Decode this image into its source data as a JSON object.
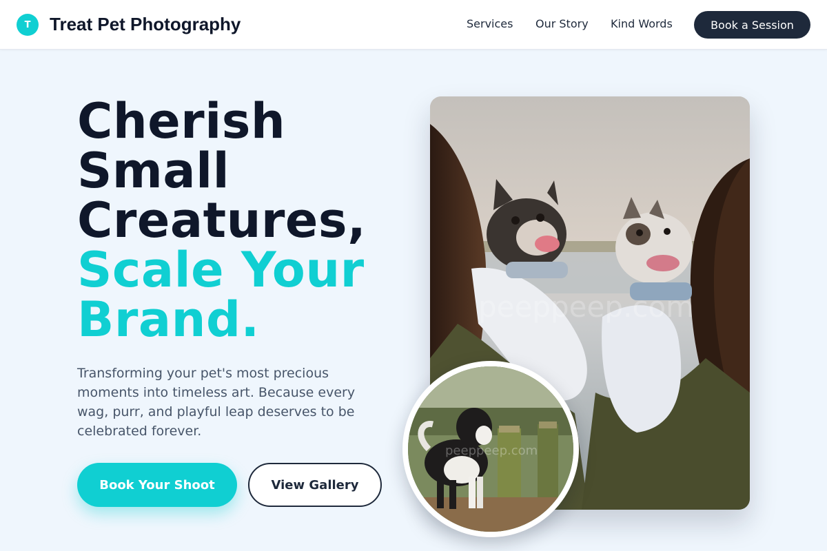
{
  "brand": {
    "logo_letter": "T",
    "name": "Treat Pet Photography"
  },
  "nav": {
    "items": [
      {
        "label": "Services"
      },
      {
        "label": "Our Story"
      },
      {
        "label": "Kind Words"
      }
    ],
    "cta_label": "Book a Session"
  },
  "hero": {
    "headline_dark": [
      "Cherish",
      "Small",
      "Creatures,"
    ],
    "headline_accent": [
      "Scale Your",
      "Brand."
    ],
    "subtext": "Transforming your pet's most precious moments into timeless art. Because every wag, purr, and playful leap deserves to be celebrated forever.",
    "primary_button": "Book Your Shoot",
    "secondary_button": "View Gallery"
  },
  "images": {
    "main_alt": "Two French bulldogs carried in baby carriers by two women",
    "inset_alt": "Black and white curly-coated dog standing on a wooden dock",
    "watermark": "peeppeep.com"
  },
  "colors": {
    "accent": "#10cfd2",
    "dark": "#0f172a",
    "nav_button": "#1e293b",
    "background": "#eff6fd"
  }
}
